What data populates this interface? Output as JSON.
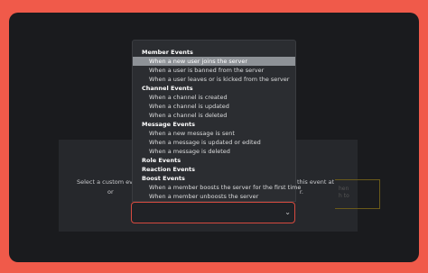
{
  "panel": {
    "text_left_1": "Select a custom ev",
    "text_right_1": "onge this event at",
    "text_left_2": "or",
    "text_right_2": "r."
  },
  "ghost_box": {
    "line1": "hen",
    "line2": "h to"
  },
  "dropdown": {
    "groups": [
      {
        "label": "Member Events",
        "options": [
          "When a new user joins the server",
          "When a user is banned from the server",
          "When a user leaves or is kicked from the server"
        ]
      },
      {
        "label": "Channel Events",
        "options": [
          "When a channel is created",
          "When a channel is updated",
          "When a channel is deleted"
        ]
      },
      {
        "label": "Message Events",
        "options": [
          "When a new message is sent",
          "When a message is updated or edited",
          "When a message is deleted"
        ]
      },
      {
        "label": "Role Events",
        "options": []
      },
      {
        "label": "Reaction Events",
        "options": []
      },
      {
        "label": "Boost Events",
        "options": [
          "When a member boosts the server for the first time",
          "When a member unboosts the server"
        ]
      }
    ],
    "selected": "When a new user joins the server"
  },
  "select": {
    "value": "",
    "chevron_icon": "chevron-down-icon"
  },
  "colors": {
    "background": "#f05a4a",
    "window": "#1a1b1e",
    "panel": "#26282c",
    "select_border": "#d64a3f",
    "selected_option": "#8e9297"
  }
}
